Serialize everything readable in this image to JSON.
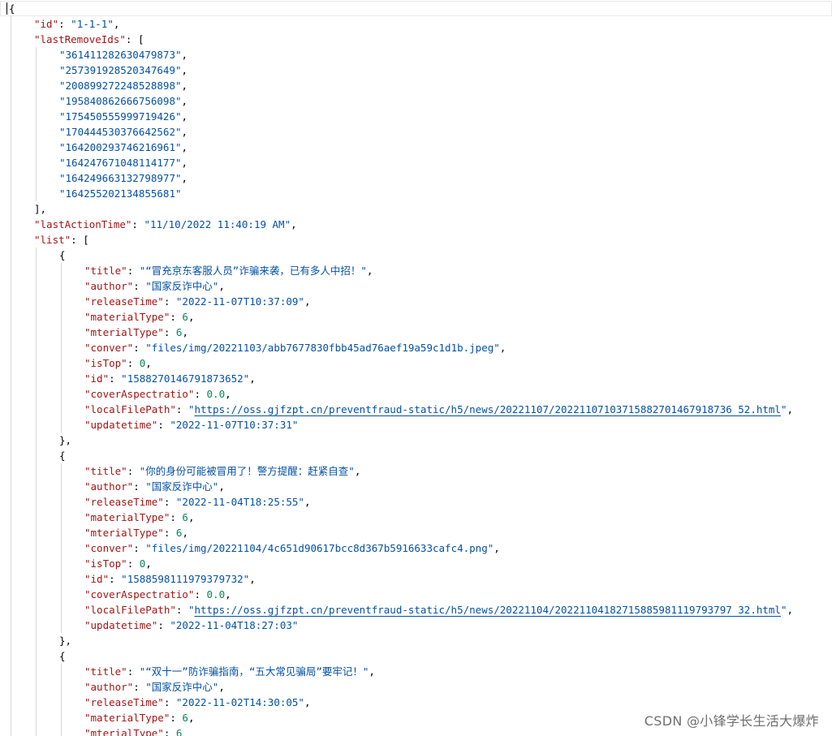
{
  "editor": {
    "watermark": "CSDN @小锋学长生活大爆炸",
    "colors": {
      "key": "#a31515",
      "string": "#0451a5",
      "number": "#098658",
      "guide": "#d8d8d8"
    }
  },
  "code": {
    "lines": [
      {
        "indent": 0,
        "tokens": [
          {
            "t": "p",
            "v": "{"
          }
        ],
        "active": true
      },
      {
        "indent": 1,
        "tokens": [
          {
            "t": "k",
            "v": "\"id\""
          },
          {
            "t": "p",
            "v": ": "
          },
          {
            "t": "s",
            "v": "\"1-1-1\""
          },
          {
            "t": "p",
            "v": ","
          }
        ]
      },
      {
        "indent": 1,
        "tokens": [
          {
            "t": "k",
            "v": "\"lastRemoveIds\""
          },
          {
            "t": "p",
            "v": ": ["
          }
        ]
      },
      {
        "indent": 2,
        "tokens": [
          {
            "t": "s",
            "v": "\"361411282630479873\""
          },
          {
            "t": "p",
            "v": ","
          }
        ]
      },
      {
        "indent": 2,
        "tokens": [
          {
            "t": "s",
            "v": "\"257391928520347649\""
          },
          {
            "t": "p",
            "v": ","
          }
        ]
      },
      {
        "indent": 2,
        "tokens": [
          {
            "t": "s",
            "v": "\"200899272248528898\""
          },
          {
            "t": "p",
            "v": ","
          }
        ]
      },
      {
        "indent": 2,
        "tokens": [
          {
            "t": "s",
            "v": "\"195840862666756098\""
          },
          {
            "t": "p",
            "v": ","
          }
        ]
      },
      {
        "indent": 2,
        "tokens": [
          {
            "t": "s",
            "v": "\"175450555999719426\""
          },
          {
            "t": "p",
            "v": ","
          }
        ]
      },
      {
        "indent": 2,
        "tokens": [
          {
            "t": "s",
            "v": "\"170444530376642562\""
          },
          {
            "t": "p",
            "v": ","
          }
        ]
      },
      {
        "indent": 2,
        "tokens": [
          {
            "t": "s",
            "v": "\"164200293746216961\""
          },
          {
            "t": "p",
            "v": ","
          }
        ]
      },
      {
        "indent": 2,
        "tokens": [
          {
            "t": "s",
            "v": "\"164247671048114177\""
          },
          {
            "t": "p",
            "v": ","
          }
        ]
      },
      {
        "indent": 2,
        "tokens": [
          {
            "t": "s",
            "v": "\"164249663132798977\""
          },
          {
            "t": "p",
            "v": ","
          }
        ]
      },
      {
        "indent": 2,
        "tokens": [
          {
            "t": "s",
            "v": "\"164255202134855681\""
          }
        ]
      },
      {
        "indent": 1,
        "tokens": [
          {
            "t": "p",
            "v": "],"
          }
        ]
      },
      {
        "indent": 1,
        "tokens": [
          {
            "t": "k",
            "v": "\"lastActionTime\""
          },
          {
            "t": "p",
            "v": ": "
          },
          {
            "t": "s",
            "v": "\"11/10/2022 11:40:19 AM\""
          },
          {
            "t": "p",
            "v": ","
          }
        ]
      },
      {
        "indent": 1,
        "tokens": [
          {
            "t": "k",
            "v": "\"list\""
          },
          {
            "t": "p",
            "v": ": ["
          }
        ]
      },
      {
        "indent": 2,
        "tokens": [
          {
            "t": "p",
            "v": "{"
          }
        ]
      },
      {
        "indent": 3,
        "tokens": [
          {
            "t": "k",
            "v": "\"title\""
          },
          {
            "t": "p",
            "v": ": "
          },
          {
            "t": "s",
            "v": "\"“冒充京东客服人员”诈骗来袭，已有多人中招！\""
          },
          {
            "t": "p",
            "v": ","
          }
        ]
      },
      {
        "indent": 3,
        "tokens": [
          {
            "t": "k",
            "v": "\"author\""
          },
          {
            "t": "p",
            "v": ": "
          },
          {
            "t": "s",
            "v": "\"国家反诈中心\""
          },
          {
            "t": "p",
            "v": ","
          }
        ]
      },
      {
        "indent": 3,
        "tokens": [
          {
            "t": "k",
            "v": "\"releaseTime\""
          },
          {
            "t": "p",
            "v": ": "
          },
          {
            "t": "s",
            "v": "\"2022-11-07T10:37:09\""
          },
          {
            "t": "p",
            "v": ","
          }
        ]
      },
      {
        "indent": 3,
        "tokens": [
          {
            "t": "k",
            "v": "\"materialType\""
          },
          {
            "t": "p",
            "v": ": "
          },
          {
            "t": "n",
            "v": "6"
          },
          {
            "t": "p",
            "v": ","
          }
        ]
      },
      {
        "indent": 3,
        "tokens": [
          {
            "t": "k",
            "v": "\"mterialType\""
          },
          {
            "t": "p",
            "v": ": "
          },
          {
            "t": "n",
            "v": "6"
          },
          {
            "t": "p",
            "v": ","
          }
        ]
      },
      {
        "indent": 3,
        "tokens": [
          {
            "t": "k",
            "v": "\"conver\""
          },
          {
            "t": "p",
            "v": ": "
          },
          {
            "t": "s",
            "v": "\"files/img/20221103/abb7677830fbb45ad76aef19a59c1d1b.jpeg\""
          },
          {
            "t": "p",
            "v": ","
          }
        ]
      },
      {
        "indent": 3,
        "tokens": [
          {
            "t": "k",
            "v": "\"isTop\""
          },
          {
            "t": "p",
            "v": ": "
          },
          {
            "t": "n",
            "v": "0"
          },
          {
            "t": "p",
            "v": ","
          }
        ]
      },
      {
        "indent": 3,
        "tokens": [
          {
            "t": "k",
            "v": "\"id\""
          },
          {
            "t": "p",
            "v": ": "
          },
          {
            "t": "s",
            "v": "\"1588270146791873652\""
          },
          {
            "t": "p",
            "v": ","
          }
        ]
      },
      {
        "indent": 3,
        "tokens": [
          {
            "t": "k",
            "v": "\"coverAspectratio\""
          },
          {
            "t": "p",
            "v": ": "
          },
          {
            "t": "n",
            "v": "0.0"
          },
          {
            "t": "p",
            "v": ","
          }
        ]
      },
      {
        "indent": 3,
        "tokens": [
          {
            "t": "k",
            "v": "\"localFilePath\""
          },
          {
            "t": "p",
            "v": ": "
          },
          {
            "t": "s",
            "v": "\""
          },
          {
            "t": "link",
            "v": "https://oss.gjfzpt.cn/preventfraud-static/h5/news/20221107/20221107103715882701467918736 52.html"
          },
          {
            "t": "s",
            "v": "\""
          },
          {
            "t": "p",
            "v": ","
          }
        ]
      },
      {
        "indent": 3,
        "tokens": [
          {
            "t": "k",
            "v": "\"updatetime\""
          },
          {
            "t": "p",
            "v": ": "
          },
          {
            "t": "s",
            "v": "\"2022-11-07T10:37:31\""
          }
        ]
      },
      {
        "indent": 2,
        "tokens": [
          {
            "t": "p",
            "v": "},"
          }
        ]
      },
      {
        "indent": 2,
        "tokens": [
          {
            "t": "p",
            "v": "{"
          }
        ]
      },
      {
        "indent": 3,
        "tokens": [
          {
            "t": "k",
            "v": "\"title\""
          },
          {
            "t": "p",
            "v": ": "
          },
          {
            "t": "s",
            "v": "\"你的身份可能被冒用了！警方提醒：赶紧自查\""
          },
          {
            "t": "p",
            "v": ","
          }
        ]
      },
      {
        "indent": 3,
        "tokens": [
          {
            "t": "k",
            "v": "\"author\""
          },
          {
            "t": "p",
            "v": ": "
          },
          {
            "t": "s",
            "v": "\"国家反诈中心\""
          },
          {
            "t": "p",
            "v": ","
          }
        ]
      },
      {
        "indent": 3,
        "tokens": [
          {
            "t": "k",
            "v": "\"releaseTime\""
          },
          {
            "t": "p",
            "v": ": "
          },
          {
            "t": "s",
            "v": "\"2022-11-04T18:25:55\""
          },
          {
            "t": "p",
            "v": ","
          }
        ]
      },
      {
        "indent": 3,
        "tokens": [
          {
            "t": "k",
            "v": "\"materialType\""
          },
          {
            "t": "p",
            "v": ": "
          },
          {
            "t": "n",
            "v": "6"
          },
          {
            "t": "p",
            "v": ","
          }
        ]
      },
      {
        "indent": 3,
        "tokens": [
          {
            "t": "k",
            "v": "\"mterialType\""
          },
          {
            "t": "p",
            "v": ": "
          },
          {
            "t": "n",
            "v": "6"
          },
          {
            "t": "p",
            "v": ","
          }
        ]
      },
      {
        "indent": 3,
        "tokens": [
          {
            "t": "k",
            "v": "\"conver\""
          },
          {
            "t": "p",
            "v": ": "
          },
          {
            "t": "s",
            "v": "\"files/img/20221104/4c651d90617bcc8d367b5916633cafc4.png\""
          },
          {
            "t": "p",
            "v": ","
          }
        ]
      },
      {
        "indent": 3,
        "tokens": [
          {
            "t": "k",
            "v": "\"isTop\""
          },
          {
            "t": "p",
            "v": ": "
          },
          {
            "t": "n",
            "v": "0"
          },
          {
            "t": "p",
            "v": ","
          }
        ]
      },
      {
        "indent": 3,
        "tokens": [
          {
            "t": "k",
            "v": "\"id\""
          },
          {
            "t": "p",
            "v": ": "
          },
          {
            "t": "s",
            "v": "\"1588598111979379732\""
          },
          {
            "t": "p",
            "v": ","
          }
        ]
      },
      {
        "indent": 3,
        "tokens": [
          {
            "t": "k",
            "v": "\"coverAspectratio\""
          },
          {
            "t": "p",
            "v": ": "
          },
          {
            "t": "n",
            "v": "0.0"
          },
          {
            "t": "p",
            "v": ","
          }
        ]
      },
      {
        "indent": 3,
        "tokens": [
          {
            "t": "k",
            "v": "\"localFilePath\""
          },
          {
            "t": "p",
            "v": ": "
          },
          {
            "t": "s",
            "v": "\""
          },
          {
            "t": "link",
            "v": "https://oss.gjfzpt.cn/preventfraud-static/h5/news/20221104/20221104182715885981119793797 32.html"
          },
          {
            "t": "s",
            "v": "\""
          },
          {
            "t": "p",
            "v": ","
          }
        ]
      },
      {
        "indent": 3,
        "tokens": [
          {
            "t": "k",
            "v": "\"updatetime\""
          },
          {
            "t": "p",
            "v": ": "
          },
          {
            "t": "s",
            "v": "\"2022-11-04T18:27:03\""
          }
        ]
      },
      {
        "indent": 2,
        "tokens": [
          {
            "t": "p",
            "v": "},"
          }
        ]
      },
      {
        "indent": 2,
        "tokens": [
          {
            "t": "p",
            "v": "{"
          }
        ]
      },
      {
        "indent": 3,
        "tokens": [
          {
            "t": "k",
            "v": "\"title\""
          },
          {
            "t": "p",
            "v": ": "
          },
          {
            "t": "s",
            "v": "\"“双十一”防诈骗指南，“五大常见骗局”要牢记！\""
          },
          {
            "t": "p",
            "v": ","
          }
        ]
      },
      {
        "indent": 3,
        "tokens": [
          {
            "t": "k",
            "v": "\"author\""
          },
          {
            "t": "p",
            "v": ": "
          },
          {
            "t": "s",
            "v": "\"国家反诈中心\""
          },
          {
            "t": "p",
            "v": ","
          }
        ]
      },
      {
        "indent": 3,
        "tokens": [
          {
            "t": "k",
            "v": "\"releaseTime\""
          },
          {
            "t": "p",
            "v": ": "
          },
          {
            "t": "s",
            "v": "\"2022-11-02T14:30:05\""
          },
          {
            "t": "p",
            "v": ","
          }
        ]
      },
      {
        "indent": 3,
        "tokens": [
          {
            "t": "k",
            "v": "\"materialType\""
          },
          {
            "t": "p",
            "v": ": "
          },
          {
            "t": "n",
            "v": "6"
          },
          {
            "t": "p",
            "v": ","
          }
        ]
      },
      {
        "indent": 3,
        "tokens": [
          {
            "t": "k",
            "v": "\"mterialType\""
          },
          {
            "t": "p",
            "v": ": "
          },
          {
            "t": "n",
            "v": "6"
          }
        ]
      }
    ]
  }
}
